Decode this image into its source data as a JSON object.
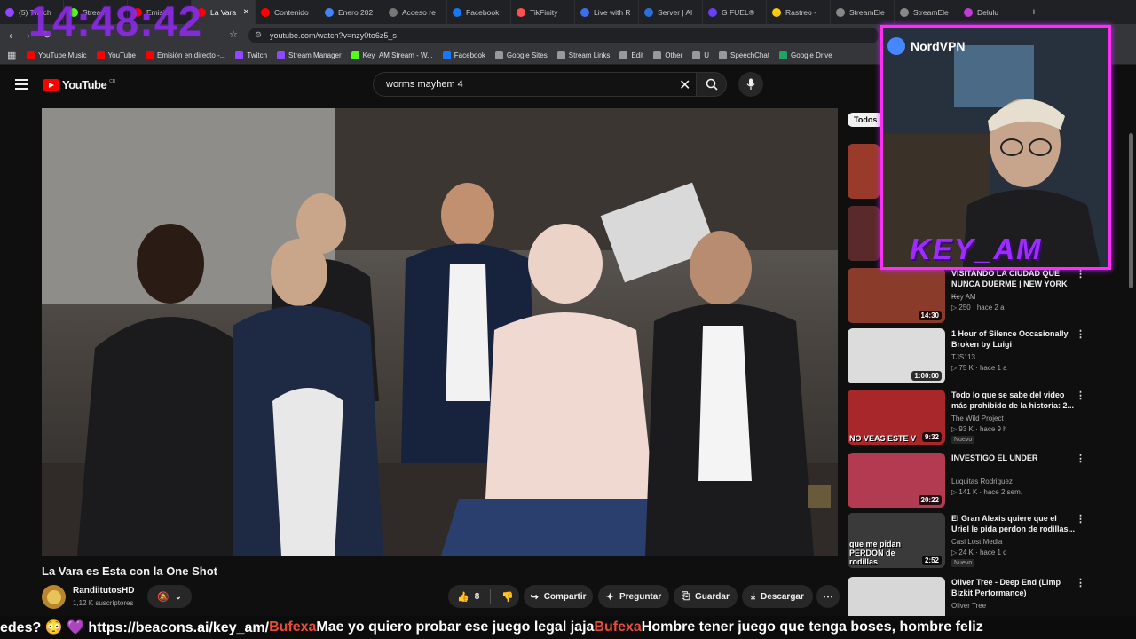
{
  "browser": {
    "tabs": [
      {
        "label": "(5) Twitch",
        "color": "#9146ff"
      },
      {
        "label": "Stream",
        "color": "#53fc18"
      },
      {
        "label": "Emisión",
        "color": "#ff0000"
      },
      {
        "label": "La Vara",
        "color": "#ff0000",
        "active": true
      },
      {
        "label": "Contenido",
        "color": "#ff0000"
      },
      {
        "label": "Enero 202",
        "color": "#4285f4"
      },
      {
        "label": "Acceso re",
        "color": "#777777"
      },
      {
        "label": "Facebook",
        "color": "#1877f2"
      },
      {
        "label": "TikFinity",
        "color": "#ff5050"
      },
      {
        "label": "Live with R",
        "color": "#3c6ff0"
      },
      {
        "label": "Server | Al",
        "color": "#2a6fdb"
      },
      {
        "label": "G FUEL®",
        "color": "#6a3dff"
      },
      {
        "label": "Rastreo -",
        "color": "#ffcc00"
      },
      {
        "label": "StreamEle",
        "color": "#888888"
      },
      {
        "label": "StreamEle",
        "color": "#888888"
      },
      {
        "label": "Delulu",
        "color": "#c13bd6"
      }
    ],
    "url": "youtube.com/watch?v=nzy0to6z5_s",
    "bookmarks": [
      {
        "label": "YouTube Music",
        "color": "#ff0000"
      },
      {
        "label": "YouTube",
        "color": "#ff0000"
      },
      {
        "label": "Emisión en directo -...",
        "color": "#ff0000"
      },
      {
        "label": "Twitch",
        "color": "#9146ff"
      },
      {
        "label": "Stream Manager",
        "color": "#9146ff"
      },
      {
        "label": "Key_AM Stream - W...",
        "color": "#53fc18"
      },
      {
        "label": "Facebook",
        "color": "#1877f2"
      },
      {
        "label": "Google Sites",
        "color": "#999999"
      },
      {
        "label": "Stream Links",
        "color": "#999999"
      },
      {
        "label": "Edit",
        "color": "#999999"
      },
      {
        "label": "Other",
        "color": "#999999"
      },
      {
        "label": "U",
        "color": "#999999"
      },
      {
        "label": "SpeechChat",
        "color": "#999999"
      },
      {
        "label": "Google Drive",
        "color": "#1fa463"
      }
    ]
  },
  "youtube": {
    "logo_text": "YouTube",
    "logo_region": "CR",
    "search_query": "worms mayhem 4",
    "filter_chip": "Todos",
    "video": {
      "title": "La Vara es Esta con la One Shot",
      "channel": "RandiitutosHD",
      "subscribers": "1,12 K suscriptores",
      "likes": "8",
      "actions": {
        "share": "Compartir",
        "ask": "Preguntar",
        "save": "Guardar",
        "download": "Descargar"
      }
    },
    "recommendations": [
      {
        "title": "VISITANDO LA CIUDAD QUE NUNCA DUERME | NEW YORK ...",
        "channel": "Key AM",
        "stats": "▷ 250 · hace 2 a",
        "duration": "14:30",
        "thumb": "#8a3b2a"
      },
      {
        "title": "1 Hour of Silence Occasionally Broken by Luigi",
        "channel": "TJS113",
        "stats": "▷ 75 K · hace 1 a",
        "duration": "1:00:00",
        "thumb": "#dcdcdc"
      },
      {
        "title": "Todo lo que se sabe del video más prohibido de la historia: 2...",
        "channel": "The Wild Project",
        "stats": "▷ 93 K · hace 9 h",
        "duration": "9:32",
        "badge": "Nuevo",
        "thumb": "#a8272b",
        "thumb_text": "NO VEAS ESTE V"
      },
      {
        "title": "INVESTIGO EL UNDER",
        "channel": "Luquitas Rodriguez",
        "stats": "▷ 141 K · hace 2 sem.",
        "duration": "20:22",
        "thumb": "#b23b52"
      },
      {
        "title": "El Gran Alexis quiere que el Uriel le pida perdon de rodillas...",
        "channel": "Casi Lost Media",
        "stats": "▷ 24 K · hace 1 d",
        "duration": "2:52",
        "badge": "Nuevo",
        "thumb": "#3a3a3a",
        "thumb_text": "que me pidan PERDON de rodillas"
      },
      {
        "title": "Oliver Tree - Deep End (Limp Bizkit Performance)",
        "channel": "Oliver Tree",
        "stats": "",
        "duration": "",
        "thumb": "#d7d7d7"
      }
    ]
  },
  "overlay": {
    "clock": "14:48:42",
    "vpn_label": "NordVPN",
    "streamer_tag": "KEY_AM",
    "ticker": [
      {
        "text": "edes? 😳 💜 https://beacons.ai/key_am/ ",
        "user": false
      },
      {
        "text": "Bufexa",
        "user": true
      },
      {
        "text": " Mae yo quiero probar ese juego legal jaja ",
        "user": false
      },
      {
        "text": "Bufexa",
        "user": true
      },
      {
        "text": " Hombre tener juego que tenga boses, hombre feliz",
        "user": false
      }
    ]
  }
}
